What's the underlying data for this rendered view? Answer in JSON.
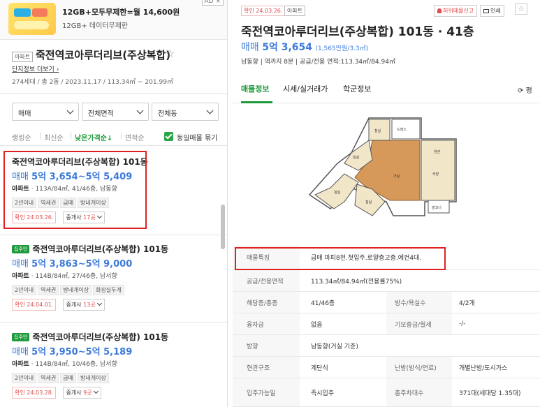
{
  "ad": {
    "title": "12GB+모두무제한=월 14,600원",
    "subtitle": "12GB+ 데이터무제한",
    "tag": "AD ×"
  },
  "complex": {
    "type_chip": "아파트",
    "name": "죽전역코아루더리브(주상복합)",
    "star": "☆",
    "info_link": "단지정보 더보기",
    "meta": "274세대 / 총 2동 / 2023.11.17 / 113.34㎡ ~ 201.99㎡"
  },
  "filters": [
    {
      "label": "매매"
    },
    {
      "label": "전체면적"
    },
    {
      "label": "전체동"
    }
  ],
  "sort": {
    "ranking": "랭킹순",
    "latest": "최신순",
    "low_price": "낮은가격순↓",
    "area": "면적순",
    "same_listing": "동일매물 묶기"
  },
  "listings": [
    {
      "resident": "",
      "title": "죽전역코아루더리브(주상복합) 101동",
      "price_label": "매매",
      "price": "5억 3,654~5억 5,409",
      "spec_type": "아파트",
      "spec": "113A/84㎡, 41/46층, 남동향",
      "tags": [
        "2년이내",
        "역세권",
        "급매",
        "방네개이상"
      ],
      "confirmed": "확인 24.03.26.",
      "agents_prefix": "중개사 ",
      "agents_count": "17곳"
    },
    {
      "resident": "집주인",
      "title": "죽전역코아루더리브(주상복합) 101동",
      "price_label": "매매",
      "price": "5억 3,863~5억 9,000",
      "spec_type": "아파트",
      "spec": "114B/84㎡, 27/46층, 남서향",
      "tags": [
        "2년이내",
        "역세권",
        "방네개이상",
        "화장실두개"
      ],
      "confirmed": "확인 24.04.01.",
      "agents_prefix": "중개사 ",
      "agents_count": "13곳"
    },
    {
      "resident": "집주인",
      "title": "죽전역코아루더리브(주상복합) 101동",
      "price_label": "매매",
      "price": "5억 3,950~5억 5,189",
      "spec_type": "아파트",
      "spec": "114B/84㎡, 10/46층, 남서향",
      "tags": [
        "2년이내",
        "역세권",
        "급매",
        "방네개이상"
      ],
      "confirmed": "확인 24.03.28.",
      "agents_prefix": "중개사 ",
      "agents_count": "9곳"
    }
  ],
  "detail": {
    "confirmed": "확인 24.03.26.",
    "type_chip": "아파트",
    "report_button": "허위매물신고",
    "print_button": "인쇄",
    "star": "☆",
    "title": "죽전역코아루더리브(주상복합) 101동 · 41층",
    "price_label": "매매",
    "price": "5억 3,654",
    "price_unit": "(1,565만원/3.3㎡)",
    "sub": "남동향 | 역까지 8분 | 공급/전용 면적:113.34㎡/84.94㎡",
    "tabs": [
      "매물정보",
      "시세/실거래가",
      "학군정보"
    ],
    "refresh": "평",
    "floorplan_room_labels": [
      "침실",
      "침실",
      "드레스",
      "거실",
      "주방",
      "침실",
      "침실",
      "현관",
      "발코니"
    ],
    "rows": [
      {
        "k": "매물특징",
        "v": "급매 마피8천.첫입주.로얄층고층.에컨4대."
      },
      {
        "k": "공급/전용면적",
        "v": "113.34㎡/84.94㎡(전용률75%)"
      },
      {
        "k": "해당층/총층",
        "v": "41/46층",
        "k2": "방수/욕실수",
        "v2": "4/2개"
      },
      {
        "k": "융자금",
        "v": "없음",
        "k2": "기보증금/월세",
        "v2": "-/-"
      },
      {
        "k": "방향",
        "v": "남동향(거실 기준)"
      },
      {
        "k": "현관구조",
        "v": "계단식",
        "k2": "난방(방식/연료)",
        "v2": "개별난방/도시가스"
      },
      {
        "k": "입주가능일",
        "v": "즉시입주",
        "k2": "총주차대수",
        "v2": "371대(세대당 1.35대)"
      }
    ]
  },
  "colors": {
    "accent_green": "#1e9a3a",
    "price_blue": "#3d7ad9",
    "highlight_red": "#e02020"
  }
}
